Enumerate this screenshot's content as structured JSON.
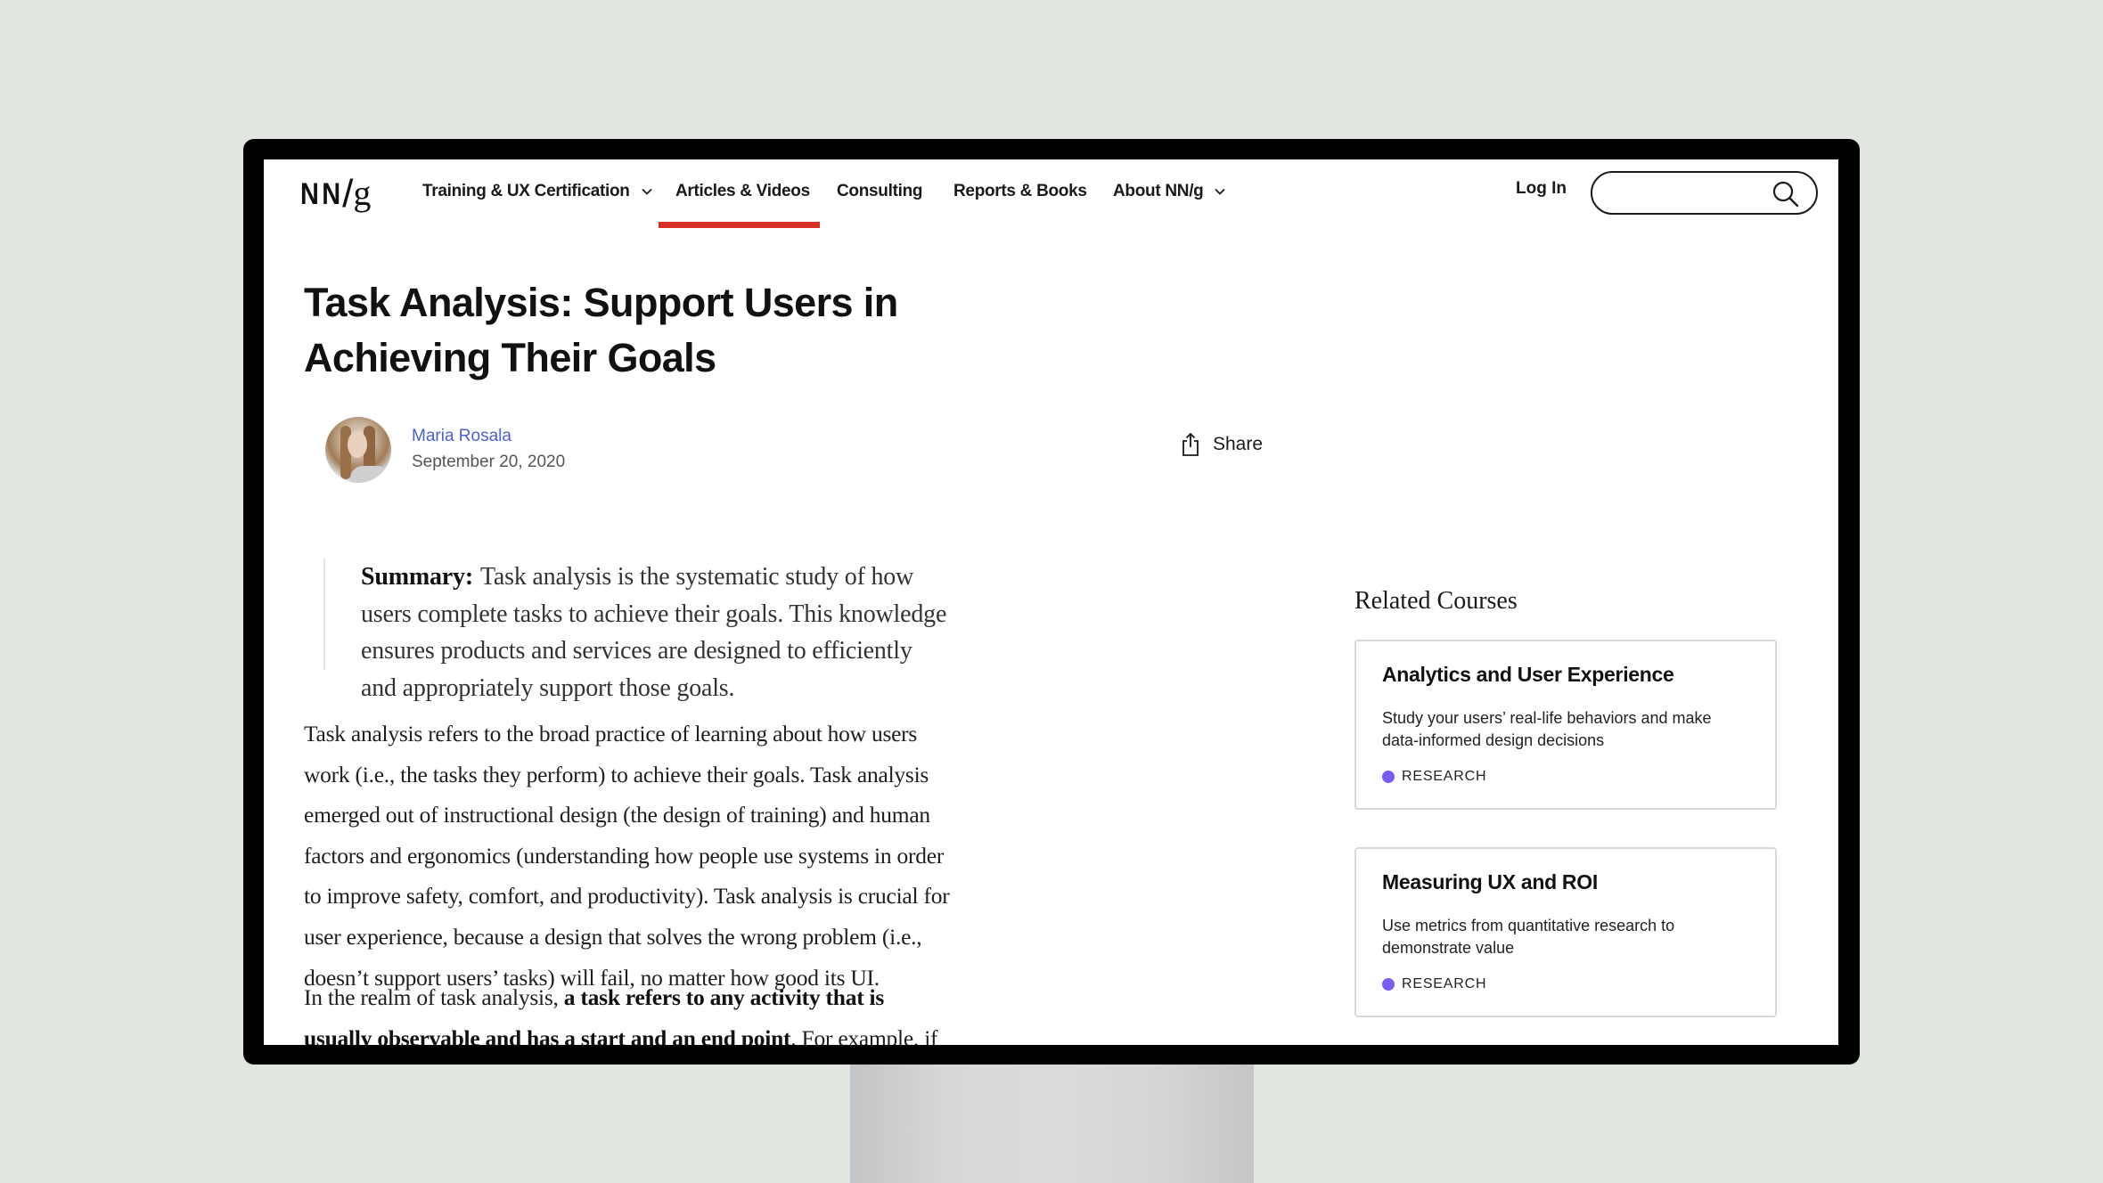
{
  "site": {
    "logo": {
      "nn": "NN",
      "slash": "/",
      "g": "g"
    }
  },
  "nav": {
    "items": [
      {
        "label": "Training & UX Certification",
        "has_dropdown": true
      },
      {
        "label": "Articles & Videos",
        "has_dropdown": false,
        "active": true
      },
      {
        "label": "Consulting",
        "has_dropdown": false
      },
      {
        "label": "Reports & Books",
        "has_dropdown": false
      },
      {
        "label": "About NN/g",
        "has_dropdown": true
      }
    ],
    "login_label": "Log In",
    "search": {
      "value": "",
      "placeholder": "",
      "icon": "search-icon"
    },
    "active_color": "#d93025"
  },
  "article": {
    "title": "Task Analysis: Support Users in Achieving Their Goals",
    "author": "Maria Rosala",
    "author_color": "#4a5fd1",
    "date": "September 20, 2020",
    "share_label": "Share",
    "summary_label": "Summary:",
    "summary_text": "Task analysis is the systematic study of how users complete tasks to achieve their goals. This knowledge ensures products and services are designed to efficiently and appropriately support those goals.",
    "paragraph1": "Task analysis refers to the broad practice of learning about how users work (i.e., the tasks they perform) to achieve their goals. Task analysis emerged out of instructional design (the design of training) and human factors and ergonomics (understanding how people use systems in order to improve safety, comfort, and productivity). Task analysis is crucial for user experience, because a design that solves the wrong problem (i.e., doesn’t support users’ tasks) will fail, no matter how good its UI.",
    "paragraph2_intro": "In the realm of task analysis, ",
    "paragraph2_bold": "a task refers to any activity that is usually observable and has a start and an end point",
    "paragraph2_rest": ". For example, if the goal is to set up a retirement fund, then the user"
  },
  "sidebar": {
    "related_title": "Related Courses",
    "courses": [
      {
        "title": "Analytics and User Experience",
        "description": "Study your users’ real-life behaviors and make data-informed design decisions",
        "tag": "RESEARCH",
        "tag_color": "#7b5cf0"
      },
      {
        "title": "Measuring UX and ROI",
        "description": "Use metrics from quantitative research to demonstrate value",
        "tag": "RESEARCH",
        "tag_color": "#7b5cf0"
      }
    ]
  }
}
